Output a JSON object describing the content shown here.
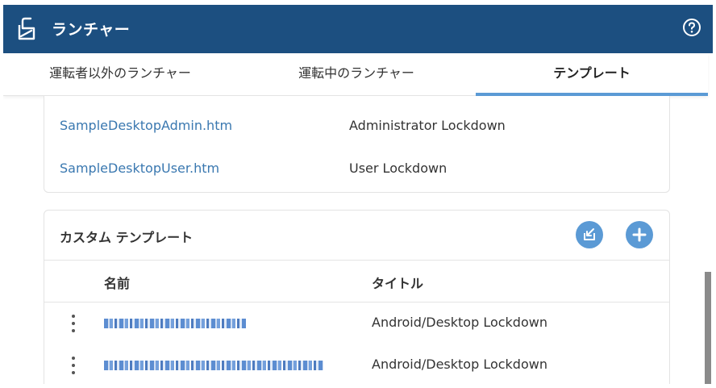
{
  "header": {
    "title": "ランチャー",
    "app_icon": "launcher-icon",
    "help_icon": "help-circle-icon"
  },
  "tabs": [
    {
      "label": "運転者以外のランチャー",
      "selected": false
    },
    {
      "label": "運転中のランチャー",
      "selected": false
    },
    {
      "label": "テンプレート",
      "selected": true
    }
  ],
  "builtin_templates": [
    {
      "file": "SampleDesktopAdmin.htm",
      "title": "Administrator Lockdown"
    },
    {
      "file": "SampleDesktopUser.htm",
      "title": "User Lockdown"
    }
  ],
  "custom_templates": {
    "heading": "カスタム テンプレート",
    "import_icon": "import-icon",
    "add_icon": "plus-icon",
    "columns": {
      "name": "名前",
      "title": "タイトル"
    },
    "rows": [
      {
        "name_obscured": true,
        "title": "Android/Desktop Lockdown"
      },
      {
        "name_obscured": true,
        "title": "Android/Desktop Lockdown"
      }
    ]
  },
  "colors": {
    "header_bg": "#1c4f80",
    "accent": "#5b9ad5",
    "link": "#3a78b0"
  }
}
